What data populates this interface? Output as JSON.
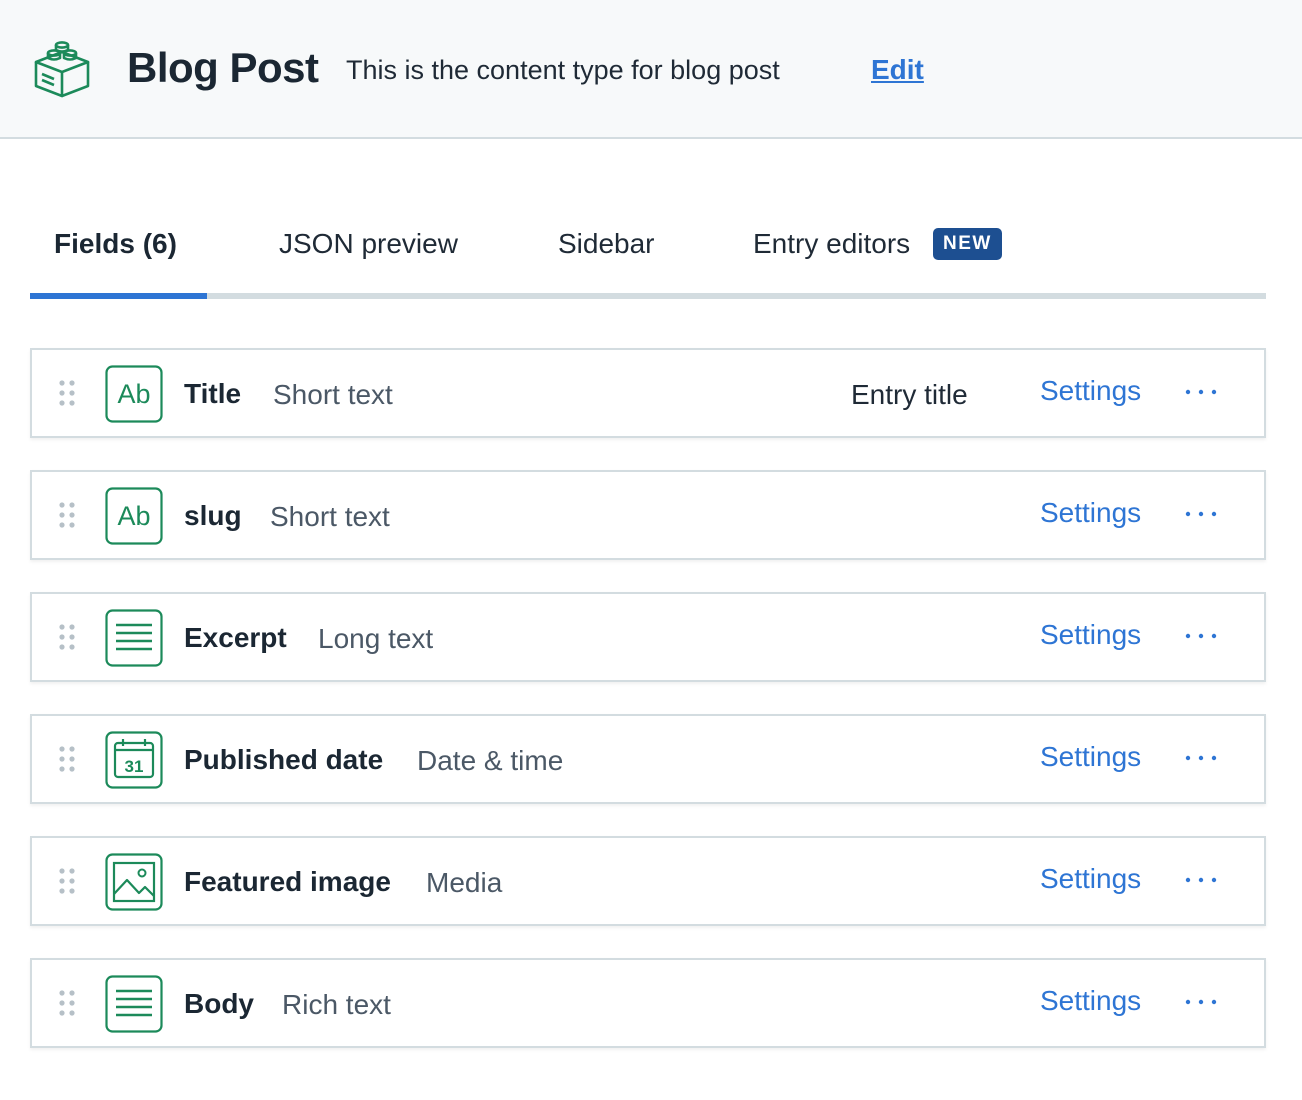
{
  "header": {
    "title": "Blog Post",
    "description": "This is the content type for blog post",
    "edit_label": "Edit"
  },
  "tabs": [
    {
      "label": "Fields (6)",
      "active": true
    },
    {
      "label": "JSON preview",
      "active": false
    },
    {
      "label": "Sidebar",
      "active": false
    },
    {
      "label": "Entry editors",
      "active": false,
      "badge": "NEW"
    }
  ],
  "fields": [
    {
      "name": "Title",
      "type": "Short text",
      "icon": "short-text-icon",
      "tag": "Entry title",
      "settings": "Settings"
    },
    {
      "name": "slug",
      "type": "Short text",
      "icon": "short-text-icon",
      "settings": "Settings"
    },
    {
      "name": "Excerpt",
      "type": "Long text",
      "icon": "long-text-icon",
      "settings": "Settings"
    },
    {
      "name": "Published date",
      "type": "Date & time",
      "icon": "calendar-icon",
      "calendar_day": "31",
      "settings": "Settings"
    },
    {
      "name": "Featured image",
      "type": "Media",
      "icon": "image-icon",
      "settings": "Settings"
    },
    {
      "name": "Body",
      "type": "Rich text",
      "icon": "rich-text-icon",
      "settings": "Settings"
    }
  ],
  "colors": {
    "accent": "#2e75d4",
    "icon_green": "#1c8a5a",
    "badge": "#1d4f91"
  }
}
